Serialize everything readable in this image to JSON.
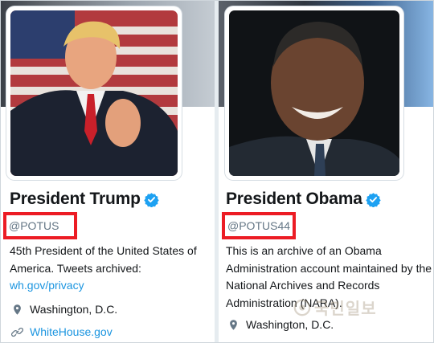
{
  "profiles": [
    {
      "name": "President Trump",
      "handle": "@POTUS",
      "bio_lines": [
        "45th President of the United States of",
        "America. Tweets archived:"
      ],
      "bio_link": "wh.gov/privacy",
      "location": "Washington, D.C.",
      "website": "WhiteHouse.gov",
      "verified_icon": "verified-badge-icon",
      "avatar_description_icon": "profile-photo"
    },
    {
      "name": "President Obama",
      "handle": "@POTUS44",
      "bio_lines": [
        "This is an archive of an Obama",
        "Administration account maintained by the",
        "National Archives and Records",
        "Administration (NARA)."
      ],
      "location": "Washington, D.C.",
      "verified_icon": "verified-badge-icon",
      "avatar_description_icon": "profile-photo"
    }
  ],
  "watermark": {
    "text": "국민일보"
  },
  "colors": {
    "highlight_box": "#ec1c24",
    "link": "#1b95e0",
    "verified": "#1da1f2",
    "handle": "#657786"
  }
}
